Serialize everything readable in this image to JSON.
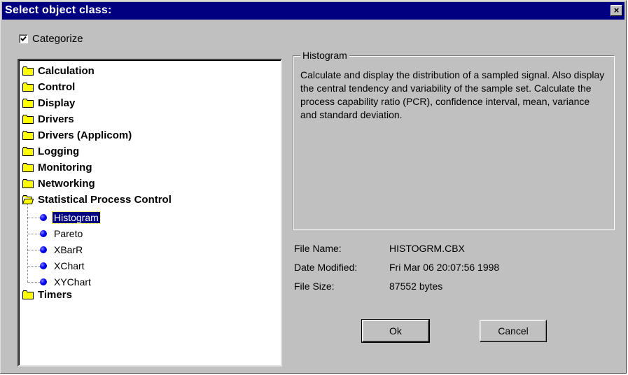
{
  "window": {
    "title": "Select object class:",
    "close_label": "×"
  },
  "categorize": {
    "label": "Categorize",
    "checked": true
  },
  "tree": {
    "categories": [
      {
        "label": "Calculation",
        "expanded": false
      },
      {
        "label": "Control",
        "expanded": false
      },
      {
        "label": "Display",
        "expanded": false
      },
      {
        "label": "Drivers",
        "expanded": false
      },
      {
        "label": "Drivers (Applicom)",
        "expanded": false
      },
      {
        "label": "Logging",
        "expanded": false
      },
      {
        "label": "Monitoring",
        "expanded": false
      },
      {
        "label": "Networking",
        "expanded": false
      },
      {
        "label": "Statistical Process Control",
        "expanded": true
      },
      {
        "label": "Timers",
        "expanded": false
      }
    ],
    "spc_children": [
      {
        "label": "Histogram",
        "selected": true
      },
      {
        "label": "Pareto",
        "selected": false
      },
      {
        "label": "XBarR",
        "selected": false
      },
      {
        "label": "XChart",
        "selected": false
      },
      {
        "label": "XYChart",
        "selected": false
      }
    ]
  },
  "description": {
    "group_title": "Histogram",
    "text": "Calculate and display the distribution of a sampled signal. Also display the central tendency and variability of the sample set. Calculate the process capability ratio (PCR), confidence interval, mean, variance and standard deviation."
  },
  "file_info": {
    "name_label": "File Name:",
    "name_value": "HISTOGRM.CBX",
    "date_label": "Date Modified:",
    "date_value": "Fri Mar 06 20:07:56 1998",
    "size_label": "File Size:",
    "size_value": "87552 bytes"
  },
  "buttons": {
    "ok": "Ok",
    "cancel": "Cancel"
  },
  "colors": {
    "titlebar": "#000080",
    "face": "#c0c0c0",
    "selection": "#000080",
    "bullet": "#0000ff",
    "folder": "#ffff00"
  }
}
